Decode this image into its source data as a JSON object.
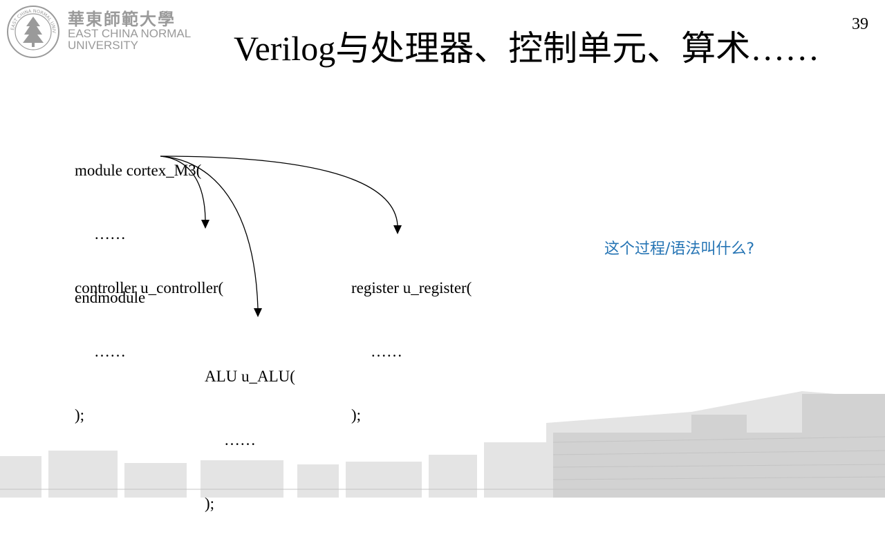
{
  "logo": {
    "cn_name": "華東師範大學",
    "en_name_line1": "EAST CHINA NORMAL",
    "en_name_line2": "UNIVERSITY",
    "ring_text": "EAST CHINA NORMAL UNIVERSITY"
  },
  "page_number": "39",
  "title": "Verilog与处理器、控制单元、算术……",
  "top_module": {
    "line1": "module cortex_M3(",
    "line2": "……",
    "line3": "endmodule"
  },
  "controller_block": {
    "line1": "controller u_controller(",
    "line2": "……",
    "line3": ");"
  },
  "register_block": {
    "line1": "register u_register(",
    "line2": "……",
    "line3": ");"
  },
  "alu_block": {
    "line1": "ALU u_ALU(",
    "line2": "……",
    "line3": ");"
  },
  "question": "这个过程/语法叫什么?",
  "colors": {
    "question": "#2574b4",
    "logo_gray": "#9a9a9a",
    "skyline": "#d9d9d9"
  }
}
